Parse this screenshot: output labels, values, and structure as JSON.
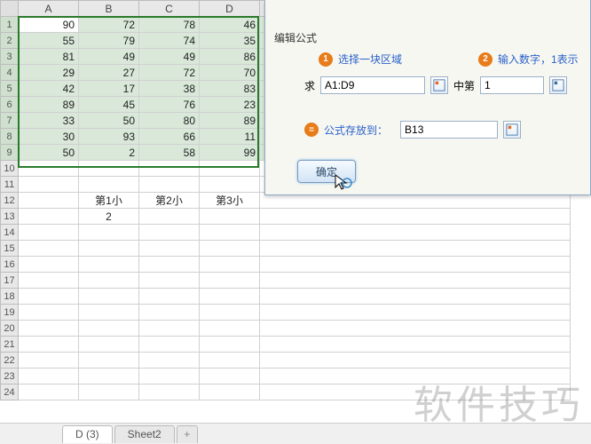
{
  "columns": [
    "A",
    "B",
    "C",
    "D"
  ],
  "rows": [
    {
      "n": "1",
      "v": [
        "90",
        "72",
        "78",
        "46"
      ],
      "sel": true,
      "first": true
    },
    {
      "n": "2",
      "v": [
        "55",
        "79",
        "74",
        "35"
      ],
      "sel": true
    },
    {
      "n": "3",
      "v": [
        "81",
        "49",
        "49",
        "86"
      ],
      "sel": true
    },
    {
      "n": "4",
      "v": [
        "29",
        "27",
        "72",
        "70"
      ],
      "sel": true
    },
    {
      "n": "5",
      "v": [
        "42",
        "17",
        "38",
        "83"
      ],
      "sel": true
    },
    {
      "n": "6",
      "v": [
        "89",
        "45",
        "76",
        "23"
      ],
      "sel": true
    },
    {
      "n": "7",
      "v": [
        "33",
        "50",
        "80",
        "89"
      ],
      "sel": true
    },
    {
      "n": "8",
      "v": [
        "30",
        "93",
        "66",
        "11"
      ],
      "sel": true
    },
    {
      "n": "9",
      "v": [
        "50",
        "2",
        "58",
        "99"
      ],
      "sel": true
    },
    {
      "n": "10",
      "v": [
        "",
        "",
        "",
        ""
      ]
    },
    {
      "n": "11",
      "v": [
        "",
        "",
        "",
        ""
      ]
    },
    {
      "n": "12",
      "v": [
        "",
        "第1小",
        "第2小",
        "第3小"
      ],
      "ctr": true
    },
    {
      "n": "13",
      "v": [
        "",
        "2",
        "",
        ""
      ],
      "ctr": true
    },
    {
      "n": "14",
      "v": [
        "",
        "",
        "",
        ""
      ]
    },
    {
      "n": "15",
      "v": [
        "",
        "",
        "",
        ""
      ]
    },
    {
      "n": "16",
      "v": [
        "",
        "",
        "",
        ""
      ]
    },
    {
      "n": "17",
      "v": [
        "",
        "",
        "",
        ""
      ]
    },
    {
      "n": "18",
      "v": [
        "",
        "",
        "",
        ""
      ]
    },
    {
      "n": "19",
      "v": [
        "",
        "",
        "",
        ""
      ]
    },
    {
      "n": "20",
      "v": [
        "",
        "",
        "",
        ""
      ]
    },
    {
      "n": "21",
      "v": [
        "",
        "",
        "",
        ""
      ]
    },
    {
      "n": "22",
      "v": [
        "",
        "",
        "",
        ""
      ]
    },
    {
      "n": "23",
      "v": [
        "",
        "",
        "",
        ""
      ]
    },
    {
      "n": "24",
      "v": [
        "",
        "",
        "",
        ""
      ]
    }
  ],
  "mini_preview_row": "8",
  "mini_badge": "1",
  "dialog": {
    "title": "编辑公式",
    "step1_badge": "1",
    "step1": "选择一块区域",
    "step2_badge": "2",
    "step2": "输入数字，1表示",
    "qiu": "求",
    "range": "A1:D9",
    "zhongdi": "中第",
    "nth": "1",
    "eq_badge": "=",
    "save_to": "公式存放到：",
    "save_cell": "B13",
    "ok": "确定"
  },
  "tabs": {
    "t1": "D (3)",
    "t2": "Sheet2",
    "plus": "+"
  },
  "watermark": "软件技巧"
}
